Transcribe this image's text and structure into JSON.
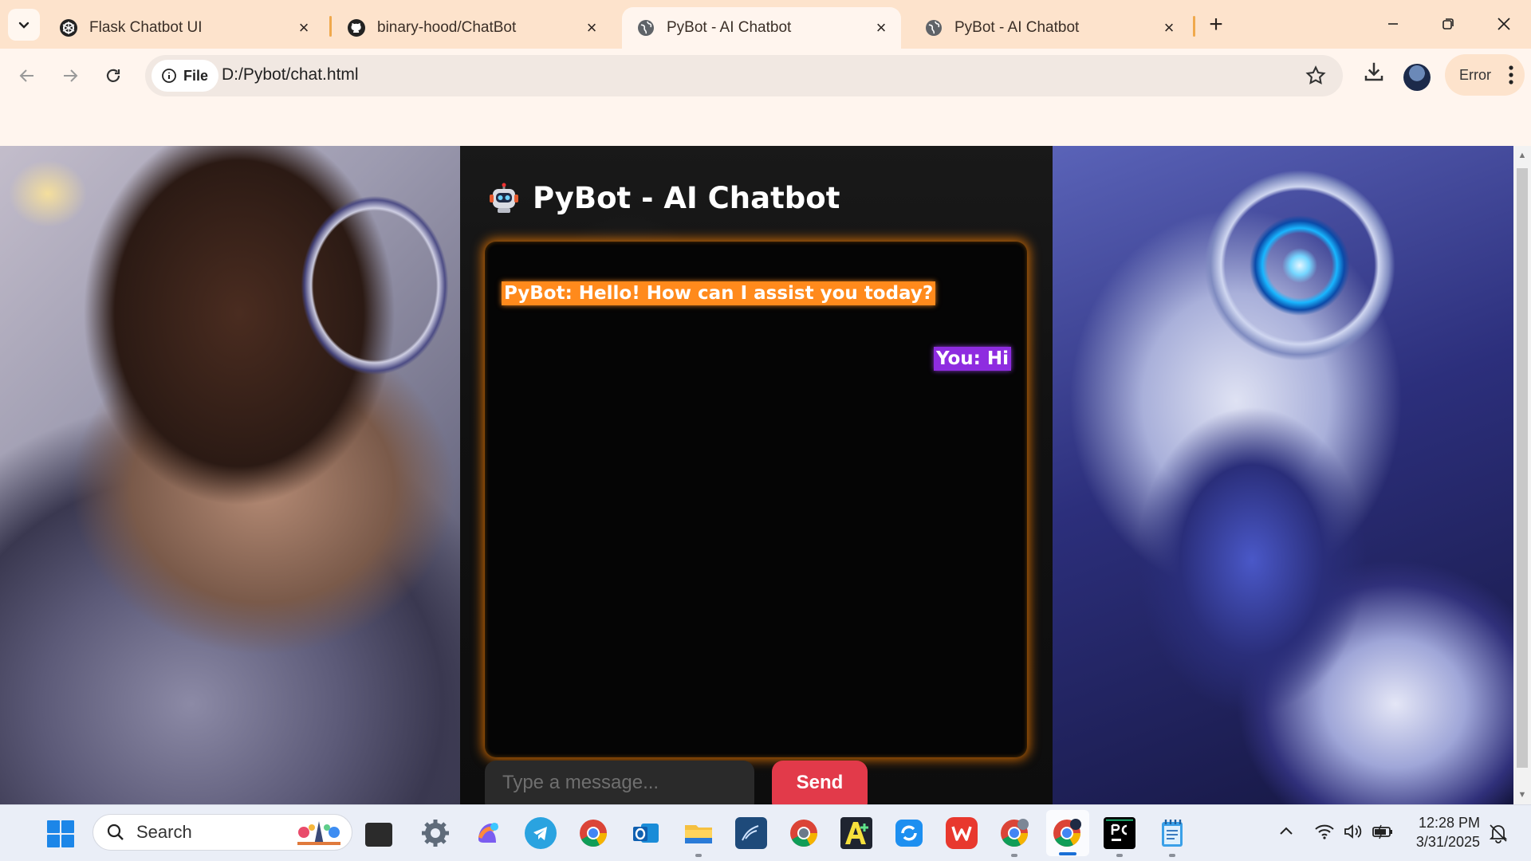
{
  "browser": {
    "tabs": [
      {
        "title": "Flask Chatbot UI",
        "icon": "openai-icon",
        "active": false
      },
      {
        "title": "binary-hood/ChatBot",
        "icon": "github-icon",
        "active": false
      },
      {
        "title": "PyBot - AI Chatbot",
        "icon": "globe-icon",
        "active": true
      },
      {
        "title": "PyBot - AI Chatbot",
        "icon": "globe-icon",
        "active": false
      }
    ],
    "new_tab_label": "+",
    "chip_label": "File",
    "url": "D:/Pybot/chat.html",
    "profile_status": "Error"
  },
  "page": {
    "title": "PyBot - AI Chatbot",
    "messages": [
      {
        "sender": "bot",
        "text": "PyBot: Hello! How can I assist you today?"
      },
      {
        "sender": "user",
        "text": "You: Hi"
      }
    ],
    "input_placeholder": "Type a message...",
    "send_label": "Send",
    "colors": {
      "bot_bubble": "#ff8a1c",
      "user_bubble": "#8e2ce0",
      "send_button": "#e23a4a",
      "glow": "#ff8200"
    }
  },
  "taskbar": {
    "search_placeholder": "Search",
    "apps": [
      "file-explorer-dark",
      "settings",
      "copilot",
      "telegram",
      "chrome",
      "outlook",
      "file-explorer",
      "mysql-workbench",
      "chrome-beta",
      "font-app",
      "sync-app",
      "wps-office",
      "chrome-profile",
      "chrome-active",
      "pycharm",
      "notepad"
    ],
    "time": "12:28 PM",
    "date": "3/31/2025"
  }
}
